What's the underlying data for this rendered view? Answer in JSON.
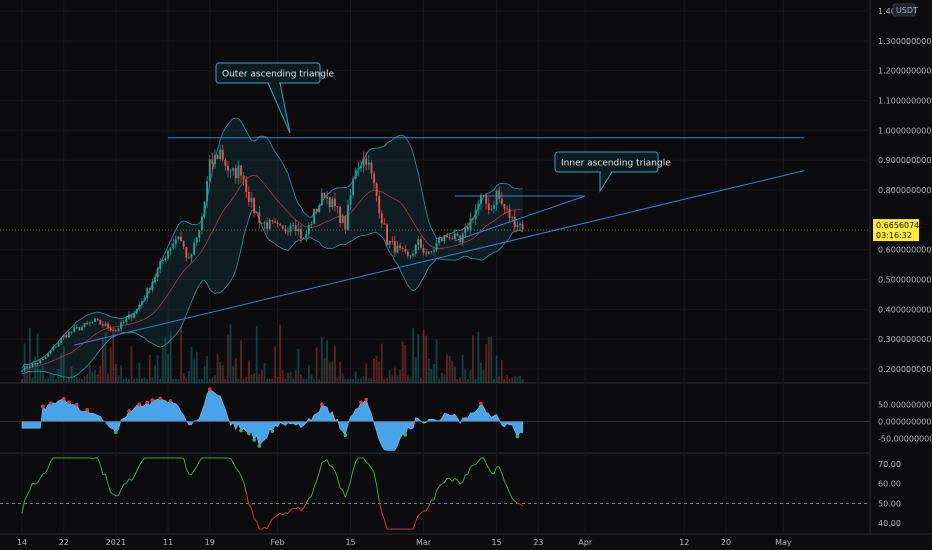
{
  "chart_data": {
    "type": "candlestick",
    "instrument_quote": "USDT",
    "price_axis": {
      "ticks": [
        "1.40",
        "1.3000000000",
        "1.2000000000",
        "1.1000000000",
        "1.0000000000",
        "0.9000000000",
        "0.8000000000",
        "0.6000000000",
        "0.5000000000",
        "0.4000000000",
        "0.3000000000",
        "0.2000000000"
      ],
      "tick_values": [
        1.4,
        1.3,
        1.2,
        1.1,
        1.0,
        0.9,
        0.8,
        0.6,
        0.5,
        0.4,
        0.3,
        0.2
      ],
      "range": [
        0.17,
        1.41
      ],
      "current_price": "0.6656074251",
      "current_sub": "03:16:32",
      "current_value": 0.6656
    },
    "time_axis": {
      "labels": [
        "14",
        "22",
        "2021",
        "11",
        "19",
        "Feb",
        "15",
        "Mar",
        "15",
        "23",
        "Apr",
        "12",
        "20",
        "May"
      ],
      "day_index": [
        0,
        8,
        18,
        28,
        36,
        49,
        63,
        77,
        91,
        99,
        108,
        127,
        135,
        146
      ]
    },
    "close_series": {
      "day_index": [
        0,
        4,
        6,
        8,
        10,
        14,
        18,
        22,
        24,
        26,
        28,
        30,
        32,
        34,
        35,
        36,
        38,
        40,
        42,
        44,
        46,
        48,
        50,
        52,
        54,
        56,
        58,
        60,
        62,
        64,
        66,
        68,
        70,
        72,
        74,
        76,
        78,
        80,
        82,
        84,
        86,
        88,
        90,
        91,
        92,
        94,
        96
      ],
      "close": [
        0.2,
        0.23,
        0.27,
        0.31,
        0.33,
        0.36,
        0.33,
        0.4,
        0.46,
        0.53,
        0.6,
        0.65,
        0.56,
        0.66,
        0.76,
        0.88,
        0.93,
        0.85,
        0.87,
        0.75,
        0.69,
        0.68,
        0.66,
        0.7,
        0.63,
        0.72,
        0.79,
        0.74,
        0.68,
        0.88,
        0.91,
        0.78,
        0.63,
        0.6,
        0.57,
        0.62,
        0.58,
        0.63,
        0.65,
        0.62,
        0.7,
        0.77,
        0.74,
        0.79,
        0.75,
        0.7,
        0.68
      ]
    },
    "trendlines": [
      {
        "name": "resistance",
        "from": [
          28,
          0.975
        ],
        "to": [
          150,
          0.975
        ]
      },
      {
        "name": "ascending-support",
        "from": [
          10,
          0.28
        ],
        "to": [
          150,
          0.865
        ]
      },
      {
        "name": "inner-top",
        "from": [
          83,
          0.78
        ],
        "to": [
          108,
          0.78
        ]
      },
      {
        "name": "inner-bottom",
        "from": [
          83,
          0.63
        ],
        "to": [
          108,
          0.78
        ]
      }
    ],
    "annotations": [
      {
        "text": "Outer ascending triangle",
        "anchor": [
          30,
          0.975
        ]
      },
      {
        "text": "Inner ascending triangle",
        "anchor": [
          103,
          0.78
        ]
      }
    ],
    "momentum_indicator": {
      "ticks": [
        "50.0000000000",
        "0.0000000000",
        "-50.0000000000"
      ],
      "tick_values": [
        50,
        0,
        -50
      ],
      "range": [
        -90,
        110
      ]
    },
    "rsi_indicator": {
      "ticks": [
        "70.00",
        "60.00",
        "50.00",
        "40.00"
      ],
      "tick_values": [
        70,
        60,
        50,
        40
      ],
      "range": [
        35,
        75
      ],
      "threshold": 50
    },
    "colors": {
      "up": "#26a69a",
      "down": "#ef5350",
      "bands": "#4fb8d3",
      "trendline": "#3a7fd8",
      "current_price_label": "#ffeb3b",
      "momentum_fill": "#4aa3e8",
      "rsi_above": "#4caf50",
      "rsi_below": "#e53935"
    }
  }
}
